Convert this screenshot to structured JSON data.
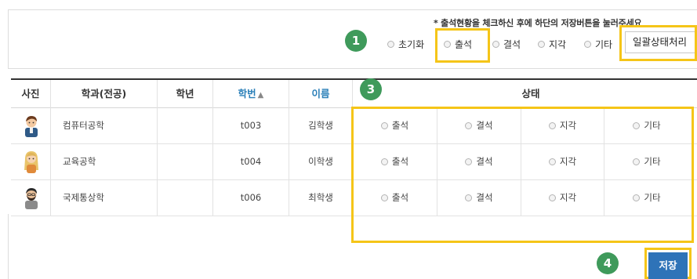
{
  "notice": "* 출석현황을 체크하신 후에 하단의 저장버튼을 눌러주세요",
  "bulk_options": [
    "초기화",
    "출석",
    "결석",
    "지각",
    "기타"
  ],
  "bulk_select_value": "일괄상태처리",
  "badges": [
    "1",
    "3",
    "4"
  ],
  "headers": {
    "photo": "사진",
    "dept": "학과(전공)",
    "year": "학년",
    "id": "학번",
    "name": "이름",
    "status": "상태"
  },
  "rows": [
    {
      "dept": "컴퓨터공학",
      "year": "",
      "id": "t003",
      "name": "김학생",
      "avatar": "male-student-avatar"
    },
    {
      "dept": "교육공학",
      "year": "",
      "id": "t004",
      "name": "이학생",
      "avatar": "female-student-avatar"
    },
    {
      "dept": "국제통상학",
      "year": "",
      "id": "t006",
      "name": "최학생",
      "avatar": "bearded-student-avatar"
    }
  ],
  "status_options": [
    "출석",
    "결석",
    "지각",
    "기타"
  ],
  "save_label": "저장",
  "colors": {
    "highlight": "#f5c518",
    "badge": "#3f9a5b",
    "link_blue": "#2a7fb8",
    "save_button": "#2e73b8"
  }
}
